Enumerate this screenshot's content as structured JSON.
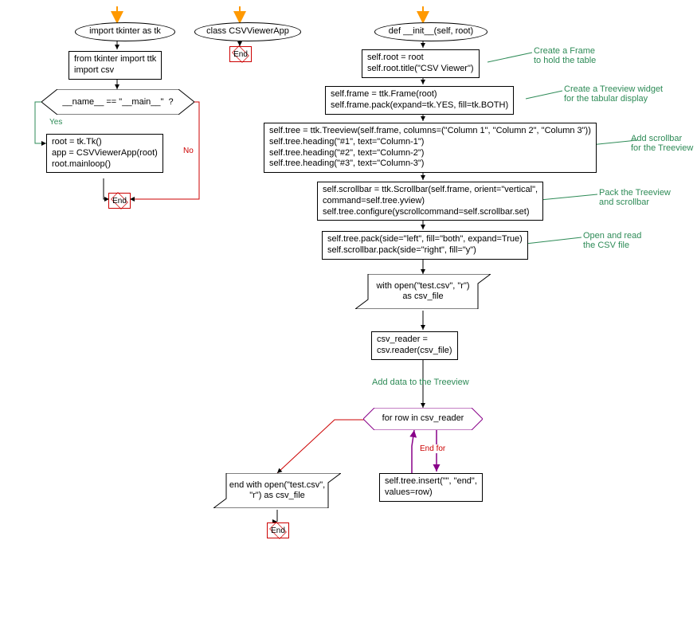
{
  "chart_data": {
    "type": "flowchart",
    "flows": [
      {
        "name": "module-main",
        "nodes": [
          {
            "id": "n1",
            "shape": "terminal",
            "text": "import tkinter as tk"
          },
          {
            "id": "n2",
            "shape": "process",
            "text": "from tkinter import ttk\nimport csv"
          },
          {
            "id": "d1",
            "shape": "decision",
            "text": "__name__ == \"__main__\"  ?"
          },
          {
            "id": "n3",
            "shape": "process",
            "text": "root = tk.Tk()\napp = CSVViewerApp(root)\nroot.mainloop()"
          },
          {
            "id": "e1",
            "shape": "end",
            "text": "End"
          }
        ],
        "edges": [
          {
            "from": "start",
            "to": "n1"
          },
          {
            "from": "n1",
            "to": "n2"
          },
          {
            "from": "n2",
            "to": "d1"
          },
          {
            "from": "d1",
            "to": "n3",
            "label": "Yes"
          },
          {
            "from": "d1",
            "to": "e1",
            "label": "No"
          },
          {
            "from": "n3",
            "to": "e1"
          }
        ]
      },
      {
        "name": "class-def",
        "nodes": [
          {
            "id": "c1",
            "shape": "terminal",
            "text": "class CSVViewerApp"
          },
          {
            "id": "ce",
            "shape": "end",
            "text": "End"
          }
        ],
        "edges": [
          {
            "from": "start",
            "to": "c1"
          },
          {
            "from": "c1",
            "to": "ce"
          }
        ]
      },
      {
        "name": "init-method",
        "nodes": [
          {
            "id": "i1",
            "shape": "terminal",
            "text": "def __init__(self, root)"
          },
          {
            "id": "i2",
            "shape": "process",
            "text": "self.root = root\nself.root.title(\"CSV Viewer\")"
          },
          {
            "id": "i3",
            "shape": "process",
            "text": "self.frame = ttk.Frame(root)\nself.frame.pack(expand=tk.YES, fill=tk.BOTH)"
          },
          {
            "id": "i4",
            "shape": "process",
            "text": "self.tree = ttk.Treeview(self.frame, columns=(\"Column 1\", \"Column 2\", \"Column 3\"))\nself.tree.heading(\"#1\", text=\"Column-1\")\nself.tree.heading(\"#2\", text=\"Column-2\")\nself.tree.heading(\"#3\", text=\"Column-3\")"
          },
          {
            "id": "i5",
            "shape": "process",
            "text": "self.scrollbar = ttk.Scrollbar(self.frame, orient=\"vertical\",\ncommand=self.tree.yview)\nself.tree.configure(yscrollcommand=self.scrollbar.set)"
          },
          {
            "id": "i6",
            "shape": "process",
            "text": "self.tree.pack(side=\"left\", fill=\"both\", expand=True)\nself.scrollbar.pack(side=\"right\", fill=\"y\")"
          },
          {
            "id": "i7",
            "shape": "io",
            "text": "with open(\"test.csv\", \"r\")\nas csv_file"
          },
          {
            "id": "i8",
            "shape": "process",
            "text": "csv_reader =\ncsv.reader(csv_file)"
          },
          {
            "id": "l1",
            "shape": "loop",
            "text": "for row in csv_reader"
          },
          {
            "id": "i9",
            "shape": "process",
            "text": "self.tree.insert(\"\", \"end\",\nvalues=row)"
          },
          {
            "id": "i10",
            "shape": "io",
            "text": "end with open(\"test.csv\",\n\"r\") as csv_file"
          },
          {
            "id": "ie",
            "shape": "end",
            "text": "End"
          }
        ],
        "edges": [
          {
            "from": "start",
            "to": "i1"
          },
          {
            "from": "i1",
            "to": "i2"
          },
          {
            "from": "i2",
            "to": "i3"
          },
          {
            "from": "i3",
            "to": "i4"
          },
          {
            "from": "i4",
            "to": "i5"
          },
          {
            "from": "i5",
            "to": "i6"
          },
          {
            "from": "i6",
            "to": "i7"
          },
          {
            "from": "i7",
            "to": "i8"
          },
          {
            "from": "i8",
            "to": "l1"
          },
          {
            "from": "l1",
            "to": "i9"
          },
          {
            "from": "i9",
            "to": "l1"
          },
          {
            "from": "l1",
            "to": "i10",
            "label": "End for"
          },
          {
            "from": "i10",
            "to": "ie"
          }
        ],
        "annotations": [
          {
            "ref": "i2",
            "text": "Create a Frame\nto hold the table"
          },
          {
            "ref": "i3",
            "text": "Create a Treeview widget\nfor the tabular display"
          },
          {
            "ref": "i4",
            "text": "Add scrollbar\nfor the Treeview"
          },
          {
            "ref": "i5",
            "text": "Pack the Treeview\nand scrollbar"
          },
          {
            "ref": "i6",
            "text": "Open and read\nthe CSV file"
          },
          {
            "ref": "i8",
            "text": "Add data to the Treeview"
          }
        ]
      }
    ]
  },
  "labels": {
    "yes": "Yes",
    "no": "No",
    "end": "End",
    "endfor": "End for"
  },
  "nodes": {
    "n1": "import tkinter as tk",
    "n2": "from tkinter import ttk\nimport csv",
    "d1": "__name__ == \"__main__\"  ?",
    "n3": "root = tk.Tk()\napp = CSVViewerApp(root)\nroot.mainloop()",
    "c1": "class CSVViewerApp",
    "i1": "def __init__(self, root)",
    "i2": "self.root = root\nself.root.title(\"CSV Viewer\")",
    "i3": "self.frame = ttk.Frame(root)\nself.frame.pack(expand=tk.YES, fill=tk.BOTH)",
    "i4": "self.tree = ttk.Treeview(self.frame, columns=(\"Column 1\", \"Column 2\", \"Column 3\"))\nself.tree.heading(\"#1\", text=\"Column-1\")\nself.tree.heading(\"#2\", text=\"Column-2\")\nself.tree.heading(\"#3\", text=\"Column-3\")",
    "i5": "self.scrollbar = ttk.Scrollbar(self.frame, orient=\"vertical\",\ncommand=self.tree.yview)\nself.tree.configure(yscrollcommand=self.scrollbar.set)",
    "i6": "self.tree.pack(side=\"left\", fill=\"both\", expand=True)\nself.scrollbar.pack(side=\"right\", fill=\"y\")",
    "i7": "with open(\"test.csv\", \"r\")\nas csv_file",
    "i8": "csv_reader =\ncsv.reader(csv_file)",
    "l1": "for row in csv_reader",
    "i9": "self.tree.insert(\"\", \"end\",\nvalues=row)",
    "i10": "end with open(\"test.csv\",\n\"r\") as csv_file",
    "a1": "Create a Frame\nto hold the table",
    "a2": "Create a Treeview widget\nfor the tabular display",
    "a3": "Add scrollbar\nfor the Treeview",
    "a4": "Pack the Treeview\nand scrollbar",
    "a5": "Open and read\nthe CSV file",
    "a6": "Add data to the Treeview"
  }
}
